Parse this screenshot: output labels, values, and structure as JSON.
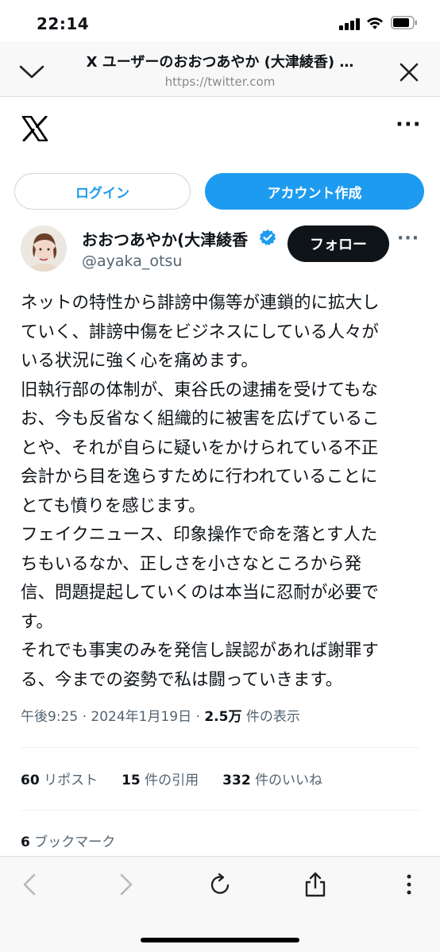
{
  "status_bar": {
    "time": "22:14"
  },
  "browser": {
    "title": "X ユーザーのおおつあやか (大津綾香) …",
    "url": "https://twitter.com"
  },
  "auth": {
    "login_label": "ログイン",
    "signup_label": "アカウント作成"
  },
  "profile": {
    "display_name": "おおつあやか(大津綾香",
    "handle": "@ayaka_otsu",
    "follow_label": "フォロー"
  },
  "tweet": {
    "text": "ネットの特性から誹謗中傷等が連鎖的に拡大し\nていく、誹謗中傷をビジネスにしている人々が\nいる状況に強く心を痛めます。\n旧執行部の体制が、東谷氏の逮捕を受けてもな\nお、今も反省なく組織的に被害を広げているこ\nとや、それが自らに疑いをかけられている不正\n会計から目を逸らすために行われていることに\nとても憤りを感じます。\nフェイクニュース、印象操作で命を落とす人た\nちもいるなか、正しさを小さなところから発\n信、問題提起していくのは本当に忍耐が必要で\nす。\nそれでも事実のみを発信し誤認があれば謝罪す\nる、今までの姿勢で私は闘っていきます。",
    "time": "午後9:25",
    "date": "2024年1月19日",
    "separator": "·",
    "views": "2.5万",
    "views_label": "件の表示"
  },
  "stats": {
    "reposts": "60",
    "reposts_label": "リポスト",
    "quotes": "15",
    "quotes_label": "件の引用",
    "likes": "332",
    "likes_label": "件のいいね",
    "bookmarks": "6",
    "bookmarks_label": "ブックマーク"
  },
  "colors": {
    "accent": "#1d9bf0",
    "dark": "#0f1419",
    "muted": "#536471"
  },
  "icons": [
    "chevron-down-icon",
    "close-icon",
    "x-logo-icon",
    "more-icon",
    "verified-icon",
    "back-icon",
    "forward-icon",
    "reload-icon",
    "share-icon"
  ]
}
